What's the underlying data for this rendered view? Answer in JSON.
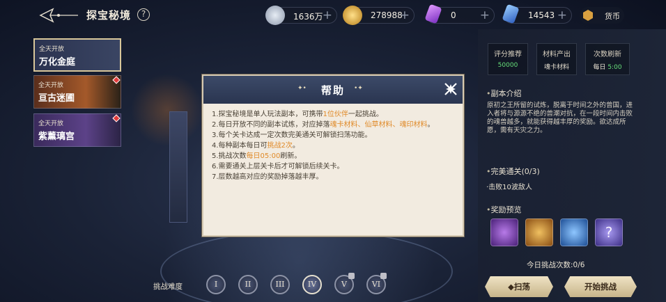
{
  "header": {
    "title": "探宝秘境",
    "help_symbol": "?"
  },
  "currencies": [
    {
      "name": "silver",
      "value": "1636万",
      "color": "#b8c2d4"
    },
    {
      "name": "gold",
      "value": "278988",
      "color": "#e0b04a"
    },
    {
      "name": "purple-crystal",
      "value": "0",
      "color": "#a24fd8"
    },
    {
      "name": "blue-crystal",
      "value": "14543",
      "color": "#5b8fe0"
    }
  ],
  "plus_symbol": "+",
  "shop_label": "货币",
  "dungeons": [
    {
      "tag": "全天开放",
      "name": "万化金庭"
    },
    {
      "tag": "全天开放",
      "name": "亘古迷圃"
    },
    {
      "tag": "全天开放",
      "name": "紫薰璃宫"
    }
  ],
  "stats": [
    {
      "label": "评分推荐",
      "value": "50000",
      "color": "#67e07a"
    },
    {
      "label": "材料产出",
      "value": "魂卡材料",
      "color": "#e8e1d1"
    },
    {
      "label": "次数刷新",
      "value_prefix": "每日 ",
      "value": "5:00",
      "color": "#67e07a"
    }
  ],
  "intro": {
    "heading": "副本介绍",
    "text": "原初之王所留的试炼，脱离于时间之外的曾国，进入者将与源源不绝的兽潮对抗，在一段时间内击败的魂兽越多，就能获得越丰厚的奖励。欲达成所愿，需有天灾之力。"
  },
  "clear": {
    "heading": "完美通关(0/3)",
    "condition": "·击败10波敌人"
  },
  "rewards_heading": "奖励预览",
  "rewards": [
    {
      "icon": "purple-chest-icon",
      "color": "#7a3fb0"
    },
    {
      "icon": "golden-star-icon",
      "color": "#c9852a"
    },
    {
      "icon": "blue-medal-icon",
      "color": "#3a78c8"
    },
    {
      "icon": "question-icon",
      "color": "#6a5ab8"
    }
  ],
  "challenge_count": "今日挑战次数:0/6",
  "buttons": {
    "sweep": "扫荡",
    "start": "开始挑战"
  },
  "difficulty": {
    "label": "挑战难度",
    "levels": [
      "I",
      "II",
      "III",
      "IV",
      "V",
      "VI"
    ],
    "selected": "IV"
  },
  "modal": {
    "title": "帮助",
    "lines": [
      [
        "1.探宝秘境是单人玩法副本，可携带",
        "1位伙伴",
        "一起挑战。",
        ""
      ],
      [
        "2.每日开放不同的副本试炼，对应掉落",
        "魂卡材料、仙草材料、魂印材料",
        "。",
        ""
      ],
      [
        "3.每个关卡达成一定次数完美通关可解锁扫荡功能。",
        "",
        "",
        ""
      ],
      [
        "4.每种副本每日可",
        "挑战2次",
        "。",
        ""
      ],
      [
        "5.挑战次数",
        "每日05:00",
        "刷新。",
        ""
      ],
      [
        "6.需要通关上层关卡后才可解锁后续关卡。",
        "",
        "",
        ""
      ],
      [
        "7.层数越高对应的奖励掉落越丰厚。",
        "",
        "",
        ""
      ]
    ]
  }
}
